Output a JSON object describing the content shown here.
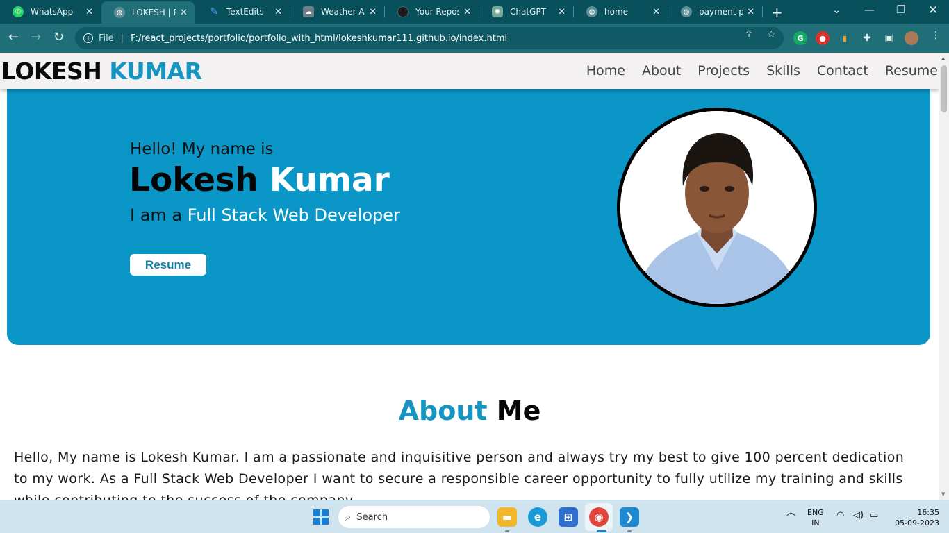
{
  "browser": {
    "tabs": [
      {
        "title": "WhatsApp",
        "icon": "whatsapp-icon",
        "color": "#25d366"
      },
      {
        "title": "LOKESH | POR",
        "icon": "globe-icon",
        "color": "#5f8f96",
        "active": true
      },
      {
        "title": "TextEdits",
        "icon": "pen-icon",
        "color": "#4aa3ff"
      },
      {
        "title": "Weather App",
        "icon": "weather-icon",
        "color": "#6f7f8a"
      },
      {
        "title": "Your Reposito",
        "icon": "github-icon",
        "color": "#1b1b1b"
      },
      {
        "title": "ChatGPT",
        "icon": "chatgpt-icon",
        "color": "#74aa9c"
      },
      {
        "title": "home",
        "icon": "globe-icon",
        "color": "#5f8f96"
      },
      {
        "title": "payment pag",
        "icon": "globe-icon",
        "color": "#5f8f96"
      }
    ],
    "omnibox": {
      "scheme_label": "File",
      "url": "F:/react_projects/portfolio/portfolio_with_html/lokeshkumar111.github.io/index.html"
    }
  },
  "site": {
    "logo": {
      "first": "LOKESH",
      "second": "KUMAR"
    },
    "menu": [
      "Home",
      "About",
      "Projects",
      "Skills",
      "Contact",
      "Resume"
    ],
    "hero": {
      "greeting": "Hello! My name is",
      "name_first": "Lokesh",
      "name_second": "Kumar",
      "role_prefix": "I am a",
      "role": "Full Stack Web Developer",
      "button": "Resume"
    },
    "about": {
      "title_hl": "About",
      "title_rest": "Me",
      "text": "Hello, My name is Lokesh Kumar. I am a passionate and inquisitive person and always try my best to give 100 percent dedication to my work. As a Full Stack Web Developer I want to secure a responsible career opportunity to fully utilize my training and skills while contributing to the success of the company."
    }
  },
  "taskbar": {
    "search_placeholder": "Search",
    "lang_top": "ENG",
    "lang_bottom": "IN",
    "time": "16:35",
    "date": "05-09-2023"
  },
  "colors": {
    "accent": "#0a96c6",
    "brand_blue": "#1595c2",
    "browser_frame": "#08505b"
  }
}
